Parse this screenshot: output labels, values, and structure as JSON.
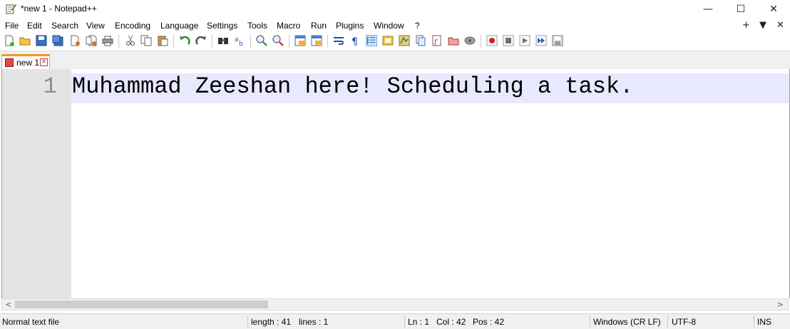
{
  "window": {
    "title": "*new 1 - Notepad++",
    "minimize": "—",
    "maximize": "☐",
    "close": "✕"
  },
  "menu": {
    "items": [
      "File",
      "Edit",
      "Search",
      "View",
      "Encoding",
      "Language",
      "Settings",
      "Tools",
      "Macro",
      "Run",
      "Plugins",
      "Window",
      "?"
    ],
    "right": [
      "+",
      "▼",
      "✕"
    ]
  },
  "toolbar": {
    "icons": [
      "new-file-icon",
      "open-file-icon",
      "save-icon",
      "save-all-icon",
      "close-icon",
      "close-all-icon",
      "print-icon",
      "cut-icon",
      "copy-icon",
      "paste-icon",
      "undo-icon",
      "redo-icon",
      "find-icon",
      "replace-icon",
      "zoom-in-icon",
      "zoom-out-icon",
      "sync-vertical-icon",
      "sync-horizontal-icon",
      "word-wrap-icon",
      "show-all-characters-icon",
      "indent-guide-icon",
      "user-defined-language-icon",
      "document-map-icon",
      "document-list-icon",
      "function-list-icon",
      "folder-as-workspace-icon",
      "monitoring-icon",
      "record-macro-icon",
      "stop-recording-icon",
      "playback-macro-icon",
      "run-macro-multiple-icon",
      "save-macro-icon"
    ]
  },
  "tab": {
    "label": "new 1",
    "close": "✕"
  },
  "editor": {
    "line_number": "1",
    "text": "Muhammad Zeeshan here! Scheduling a task."
  },
  "scrollbar": {
    "left_arrow": "<",
    "right_arrow": ">"
  },
  "status": {
    "file_type": "Normal text file",
    "length": "length : 41",
    "lines": "lines : 1",
    "ln": "Ln : 1",
    "col": "Col : 42",
    "pos": "Pos : 42",
    "eol": "Windows (CR LF)",
    "encoding": "UTF-8",
    "mode": "INS"
  }
}
